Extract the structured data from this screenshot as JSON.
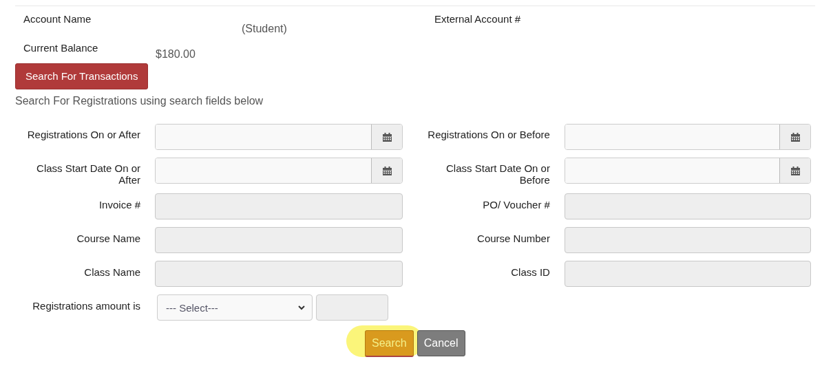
{
  "account": [
    {
      "label": "Account Name",
      "value": "(Student)"
    },
    {
      "label": "External Account #"
    },
    {
      "label": "Current Balance",
      "value": "$180.00"
    }
  ],
  "transactions_button": "Search For Transactions",
  "intro": "Search For Registrations using search fields below",
  "fields": [
    {
      "kind": "date",
      "label": "Registrations On or After"
    },
    {
      "kind": "date",
      "label": "Registrations On or Before"
    },
    {
      "kind": "date",
      "label": "Class Start Date On or After"
    },
    {
      "kind": "date",
      "label": "Class Start Date On or Before"
    },
    {
      "kind": "text",
      "label": "Invoice #"
    },
    {
      "kind": "text",
      "label": "PO/ Voucher #"
    },
    {
      "kind": "text",
      "label": "Course Name"
    },
    {
      "kind": "text",
      "label": "Course Number"
    },
    {
      "kind": "text",
      "label": "Class Name"
    },
    {
      "kind": "text",
      "label": "Class ID"
    },
    {
      "kind": "amount",
      "label": "Registrations amount is",
      "select": "--- Select---"
    }
  ],
  "buttons": [
    {
      "kind": "primary",
      "label": "Search",
      "highlighted": true
    },
    {
      "kind": "secondary",
      "label": "Cancel",
      "highlighted": false
    }
  ]
}
